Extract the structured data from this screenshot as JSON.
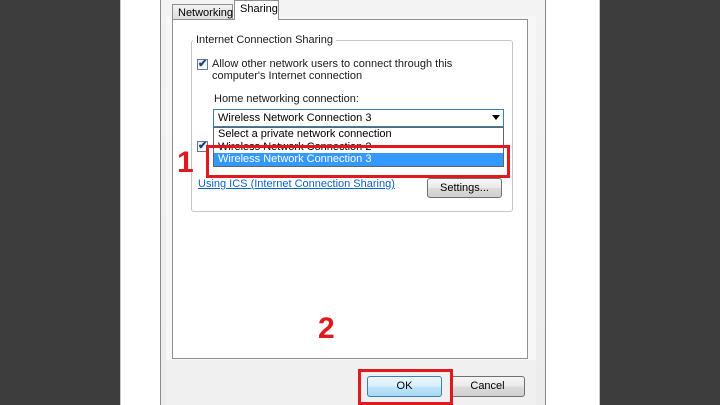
{
  "tabs": [
    {
      "label": "Networking"
    },
    {
      "label": "Sharing"
    }
  ],
  "group": {
    "legend": "Internet Connection Sharing",
    "allow_label": "Allow other network users to connect through this computer's Internet connection",
    "home_label": "Home networking connection:",
    "combo_value": "Wireless Network Connection 3",
    "options": [
      "Select a private network connection",
      "Wireless Network Connection 2",
      "Wireless Network Connection 3"
    ],
    "link": "Using ICS (Internet Connection Sharing)",
    "settings_button": "Settings..."
  },
  "buttons": {
    "ok": "OK",
    "cancel": "Cancel"
  },
  "annotations": {
    "step1": "1",
    "step2": "2"
  },
  "colors": {
    "highlight_box": "#e0191f",
    "selected_item": "#3399ff",
    "link": "#0b62cc"
  }
}
